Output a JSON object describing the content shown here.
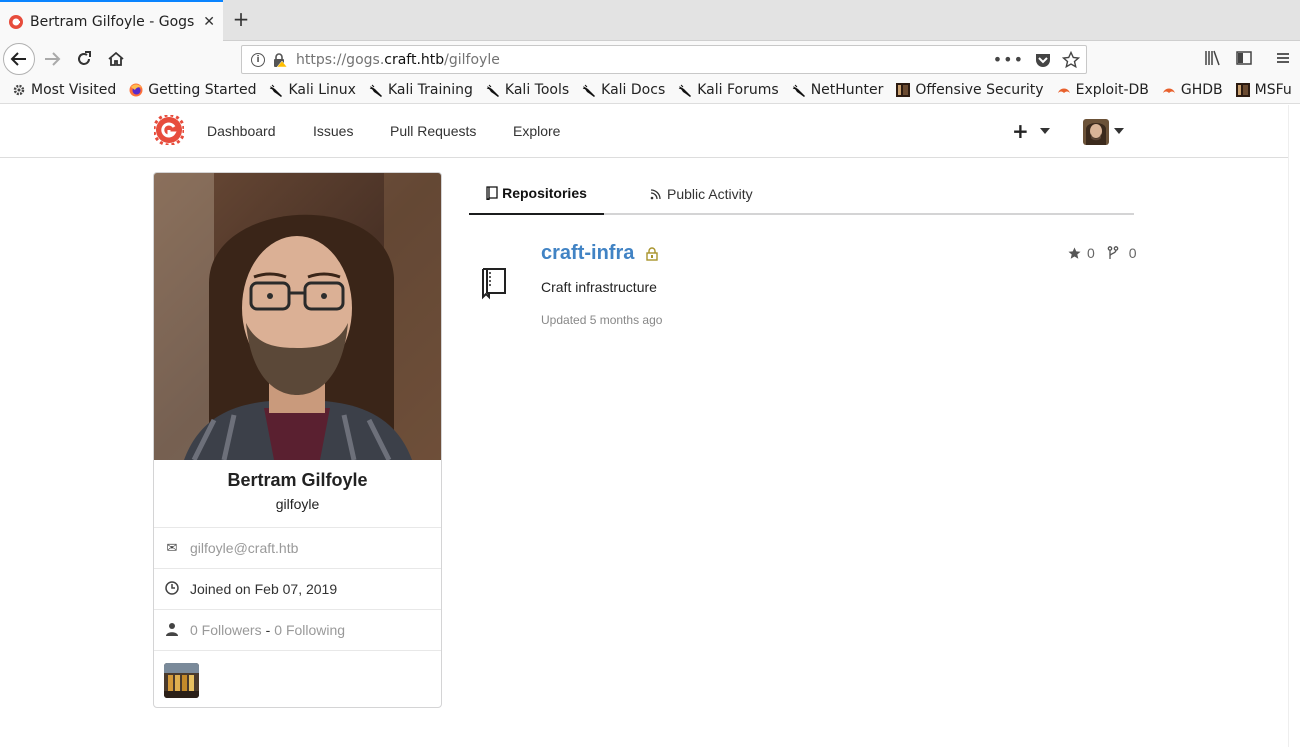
{
  "browser": {
    "tab_title": "Bertram Gilfoyle - Gogs",
    "url_prefix": "https://gogs.",
    "url_host": "craft.htb",
    "url_path": "/gilfoyle"
  },
  "bookmarks": [
    {
      "label": "Most Visited",
      "icon": "gear-icon"
    },
    {
      "label": "Getting Started",
      "icon": "firefox-icon"
    },
    {
      "label": "Kali Linux",
      "icon": "kali-dragon-icon"
    },
    {
      "label": "Kali Training",
      "icon": "kali-dragon-icon"
    },
    {
      "label": "Kali Tools",
      "icon": "kali-dragon-icon"
    },
    {
      "label": "Kali Docs",
      "icon": "kali-dragon-icon"
    },
    {
      "label": "Kali Forums",
      "icon": "kali-dragon-icon"
    },
    {
      "label": "NetHunter",
      "icon": "kali-dragon-icon"
    },
    {
      "label": "Offensive Security",
      "icon": "offsec-icon"
    },
    {
      "label": "Exploit-DB",
      "icon": "exploitdb-icon"
    },
    {
      "label": "GHDB",
      "icon": "exploitdb-icon"
    },
    {
      "label": "MSFu",
      "icon": "offsec-icon"
    }
  ],
  "topnav": {
    "dashboard": "Dashboard",
    "issues": "Issues",
    "pull_requests": "Pull Requests",
    "explore": "Explore",
    "create": "+"
  },
  "profile": {
    "full_name": "Bertram Gilfoyle",
    "username": "gilfoyle",
    "email": "gilfoyle@craft.htb",
    "joined": "Joined on Feb 07, 2019",
    "followers": "0 Followers",
    "separator": "-",
    "following": "0 Following"
  },
  "tabs": {
    "repositories": "Repositories",
    "public_activity": "Public Activity"
  },
  "repos": [
    {
      "name": "craft-infra",
      "description": "Craft infrastructure",
      "updated": "Updated 5 months ago",
      "stars": "0",
      "forks": "0"
    }
  ],
  "colors": {
    "link": "#4183c4",
    "brand": "#e74c3c"
  }
}
